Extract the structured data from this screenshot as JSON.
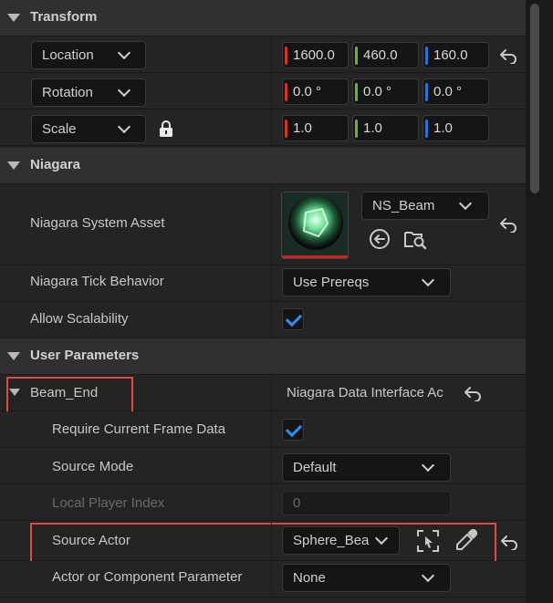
{
  "transform": {
    "title": "Transform",
    "location_label": "Location",
    "rotation_label": "Rotation",
    "scale_label": "Scale",
    "location": [
      "1600.0",
      "460.0",
      "160.0"
    ],
    "rotation": [
      "0.0 °",
      "0.0 °",
      "0.0 °"
    ],
    "scale": [
      "1.0",
      "1.0",
      "1.0"
    ]
  },
  "niagara": {
    "title": "Niagara",
    "system_asset_label": "Niagara System Asset",
    "system_asset_value": "NS_Beam",
    "tick_behavior_label": "Niagara Tick Behavior",
    "tick_behavior_value": "Use Prereqs",
    "allow_scalability_label": "Allow Scalability"
  },
  "user_parameters": {
    "title": "User Parameters",
    "beam_end_label": "Beam_End",
    "beam_end_value": "Niagara Data Interface Ac",
    "require_frame_label": "Require Current Frame Data",
    "source_mode_label": "Source Mode",
    "source_mode_value": "Default",
    "local_player_label": "Local Player Index",
    "local_player_value": "0",
    "source_actor_label": "Source Actor",
    "source_actor_value": "Sphere_Bea",
    "actor_component_label": "Actor or Component Parameter",
    "actor_component_value": "None"
  },
  "colors": {
    "x_axis": "#d9331f",
    "y_axis": "#6ab52a",
    "z_axis": "#2a74d9",
    "highlight": "#e04848",
    "check": "#2f8df5"
  },
  "icons": [
    "reset-arrow-icon",
    "lock-icon",
    "browse-to-asset-icon",
    "find-in-browser-icon",
    "select-actor-icon",
    "eyedropper-icon",
    "chevron-down-icon",
    "collapse-triangle-icon"
  ]
}
